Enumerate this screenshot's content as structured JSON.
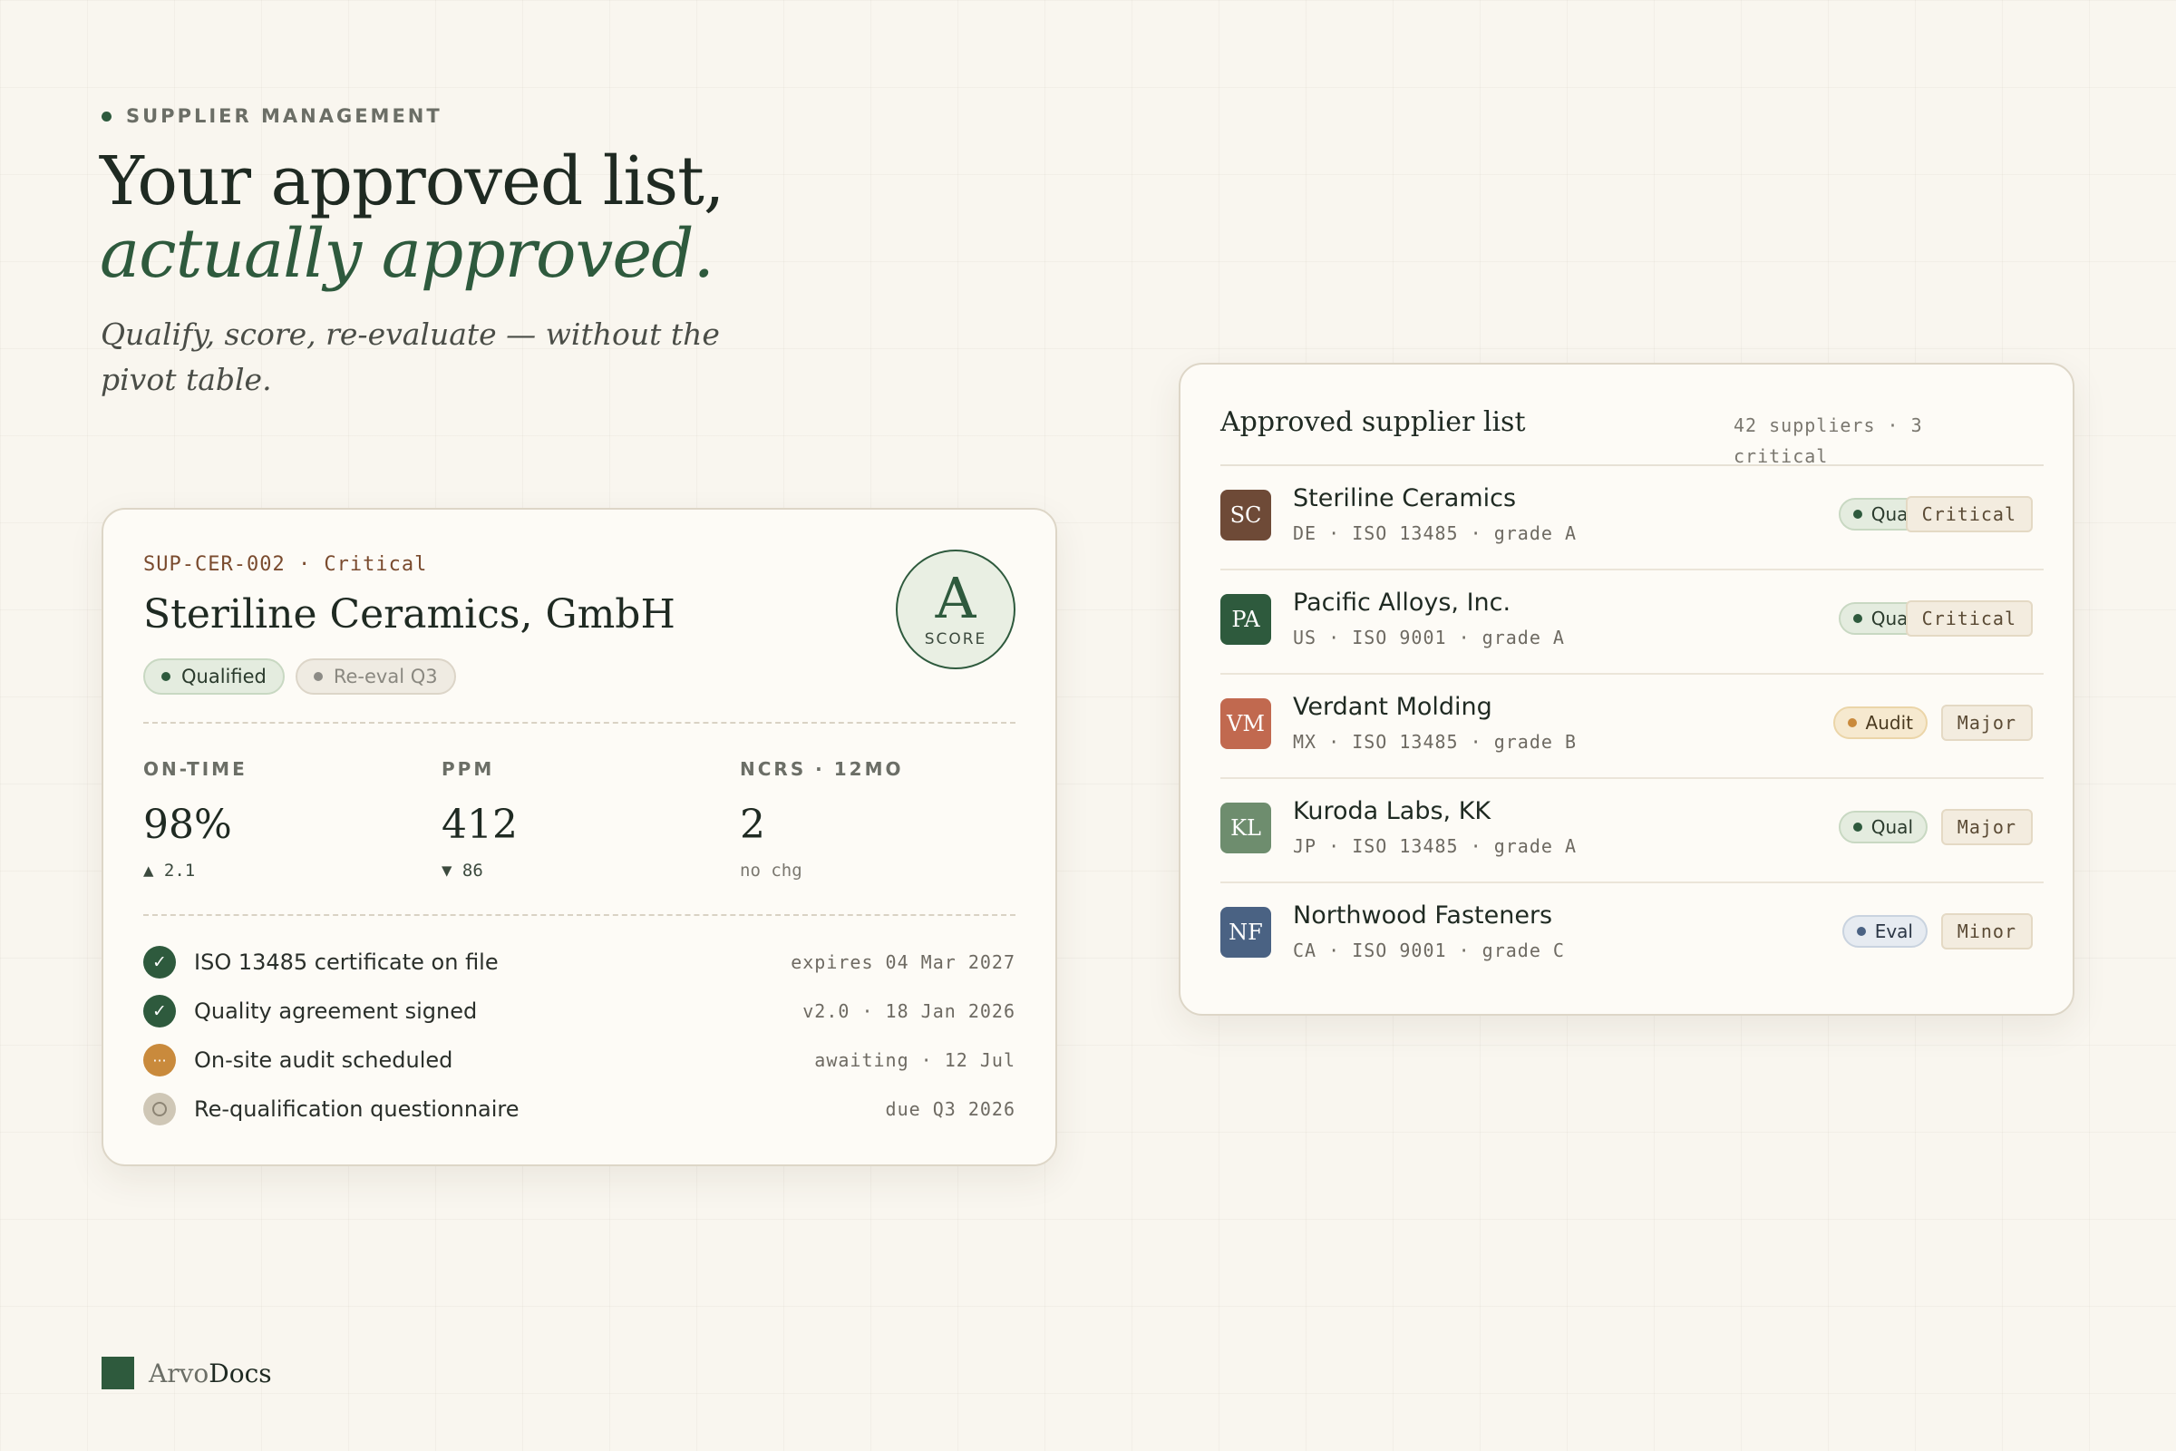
{
  "hero": {
    "eyebrow": "SUPPLIER MANAGEMENT",
    "headline_line1": "Your approved list,",
    "headline_line2": "actually approved.",
    "subline": "Qualify, score, re-evaluate — without the pivot table."
  },
  "detail_card": {
    "supplier_id": "SUP-CER-002 · Critical",
    "name": "Steriline Ceramics, GmbH",
    "chips": [
      "Qualified",
      "Re-eval Q3"
    ],
    "score_grade": "A",
    "score_label": "SCORE",
    "metrics": [
      {
        "label": "ON-TIME",
        "value": "98%",
        "delta": "▲ 2.1"
      },
      {
        "label": "PPM",
        "value": "412",
        "delta": "▼ 86"
      },
      {
        "label": "NCRS · 12MO",
        "value": "2",
        "delta": "no chg"
      }
    ],
    "checklist": [
      {
        "status": "done",
        "text": "ISO 13485 certificate on file",
        "meta": "expires 04 Mar 2027"
      },
      {
        "status": "done",
        "text": "Quality agreement signed",
        "meta": "v2.0 · 18 Jan 2026"
      },
      {
        "status": "pending",
        "text": "On-site audit scheduled",
        "meta": "awaiting · 12 Jul"
      },
      {
        "status": "todo",
        "text": "Re-qualification questionnaire",
        "meta": "due Q3 2026"
      }
    ]
  },
  "list_card": {
    "title": "Approved supplier list",
    "summary": "42 suppliers · 3 critical",
    "rows": [
      {
        "initials": "SC",
        "color": "#6e4a37",
        "name": "Steriline Ceramics",
        "meta": "DE · ISO 13485 · grade A",
        "status": "Qual",
        "severity": "Critical"
      },
      {
        "initials": "PA",
        "color": "#2e5a3d",
        "name": "Pacific Alloys, Inc.",
        "meta": "US · ISO 9001 · grade A",
        "status": "Qual",
        "severity": "Critical"
      },
      {
        "initials": "VM",
        "color": "#c1694f",
        "name": "Verdant Molding",
        "meta": "MX · ISO 13485 · grade B",
        "status": "Audit",
        "severity": "Major"
      },
      {
        "initials": "KL",
        "color": "#6e8d6e",
        "name": "Kuroda Labs, KK",
        "meta": "JP · ISO 13485 · grade A",
        "status": "Qual",
        "severity": "Major"
      },
      {
        "initials": "NF",
        "color": "#4a6283",
        "name": "Northwood Fasteners",
        "meta": "CA · ISO 9001 · grade C",
        "status": "Eval",
        "severity": "Minor"
      }
    ]
  },
  "brand": {
    "part1": "Arvo",
    "part2": "Docs"
  },
  "colors": {
    "accent": "#2e5a3d",
    "background": "#f9f6ef",
    "card": "#fdfbf6",
    "warning": "#c98a3c"
  }
}
